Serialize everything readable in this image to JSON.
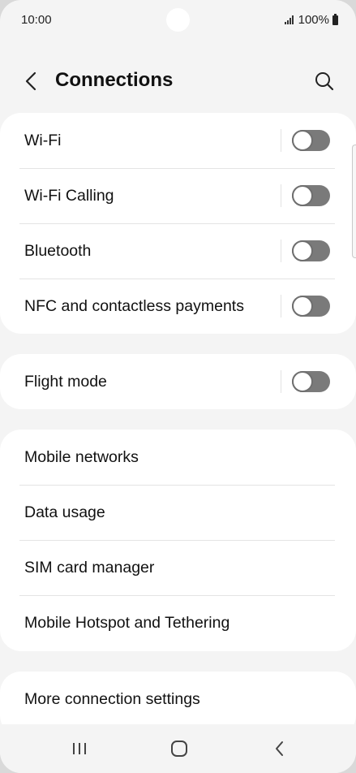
{
  "status_bar": {
    "time": "10:00",
    "battery": "100%",
    "icons": [
      "signal-icon",
      "battery-icon"
    ]
  },
  "header": {
    "title": "Connections",
    "back_icon": "chevron-left-icon",
    "search_icon": "search-icon"
  },
  "groups": [
    {
      "items": [
        {
          "label": "Wi-Fi",
          "toggle": false
        },
        {
          "label": "Wi-Fi Calling",
          "toggle": false
        },
        {
          "label": "Bluetooth",
          "toggle": false
        },
        {
          "label": "NFC and contactless payments",
          "toggle": false
        }
      ]
    },
    {
      "items": [
        {
          "label": "Flight mode",
          "toggle": false
        }
      ]
    },
    {
      "items": [
        {
          "label": "Mobile networks"
        },
        {
          "label": "Data usage"
        },
        {
          "label": "SIM card manager"
        },
        {
          "label": "Mobile Hotspot and Tethering"
        }
      ]
    },
    {
      "items": [
        {
          "label": "More connection settings"
        }
      ]
    }
  ],
  "nav_bar": {
    "icons": [
      "recent-apps-icon",
      "home-icon",
      "back-icon"
    ]
  },
  "colors": {
    "background": "#f4f4f4",
    "card": "#ffffff",
    "toggle_off": "#7a7a7a"
  }
}
